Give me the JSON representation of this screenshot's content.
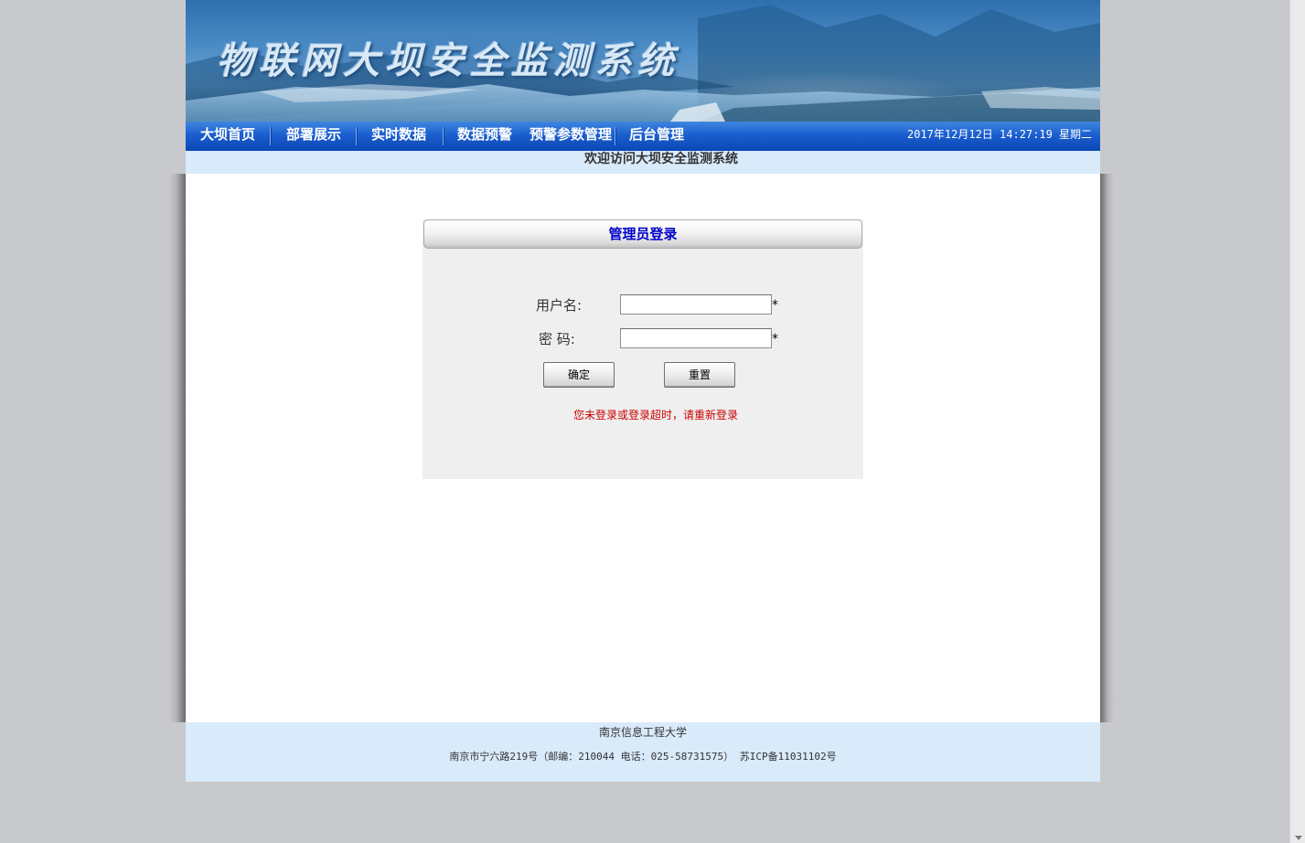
{
  "banner": {
    "title": "物联网大坝安全监测系统"
  },
  "nav": {
    "items": [
      {
        "label": "大坝首页"
      },
      {
        "label": "部署展示"
      },
      {
        "label": "实时数据"
      },
      {
        "label": "数据预警"
      },
      {
        "label": "预警参数管理"
      },
      {
        "label": "后台管理"
      }
    ],
    "datetime": "2017年12月12日 14:27:19 星期二"
  },
  "welcome": {
    "text": "欢迎访问大坝安全监测系统"
  },
  "login": {
    "title": "管理员登录",
    "username_label": "用户名:",
    "username_value": "",
    "password_label": "密 码:",
    "password_value": "",
    "required_mark": "*",
    "confirm_label": "确定",
    "reset_label": "重置",
    "error_message": "您未登录或登录超时，请重新登录"
  },
  "footer": {
    "organization": "南京信息工程大学",
    "contact": "南京市宁六路219号（邮编：210044 电话：025-58731575） 苏ICP备11031102号"
  },
  "colors": {
    "nav_background": "#1b5fcf",
    "welcome_background": "#d9eafb",
    "login_title": "#0000cc",
    "error_text": "#cc0000",
    "page_background": "#c8c9cc"
  }
}
